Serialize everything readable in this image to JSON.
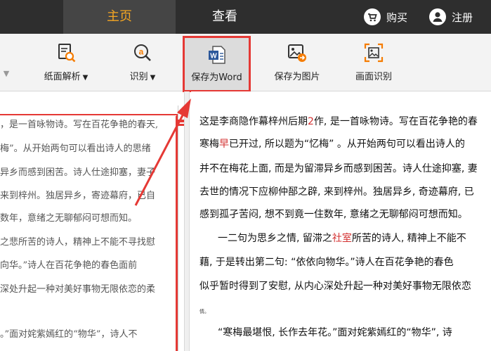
{
  "topbar": {
    "tabs": [
      {
        "label": "主页",
        "active": true
      },
      {
        "label": "查看",
        "active": false
      }
    ],
    "buy_label": "购买",
    "register_label": "注册"
  },
  "toolbar": {
    "analyze_label": "纸面解析",
    "recog_label": "识别",
    "save_word_label": "保存为Word",
    "save_image_label": "保存为图片",
    "screen_recog_label": "画面识别",
    "caret": "▼"
  },
  "left_text": [
    "，是一首咏物诗。写在百花争艳的春天,",
    "梅”。从开始两句可以看出诗人的思绪",
    "异乡而感到困苦。诗人仕途抑塞，妻子",
    "来到梓州。独居异乡，寄迹幕府，已自",
    "数年，意绪之无聊郁闷可想而知。",
    "之悲所苦的诗人，精神上不能不寻找慰",
    "向华。”诗人在百花争艳的春色面前",
    "深处升起一种对美好事物无限依恋的柔",
    "。”面对姹紫嫣红的“物华”，诗人不"
  ],
  "right_text": {
    "l1_a": "这是李商隐作幕梓州后期",
    "l1_r": "2",
    "l1_b": "作, 是一首咏物诗。写在百花争艳的春",
    "l2_a": "寒梅",
    "l2_r": "早",
    "l2_b": "已开过, 所以题为“忆梅”  。从开始两句可以看出诗人的",
    "l3": "并不在梅花上面, 而是为留滞异乡而感到困苦。诗人仕途抑塞, 妻",
    "l4": "去世的情况下应柳仲郚之辟, 来到梓州。独居异乡, 奇迹幕府, 已",
    "l5": "感到孤孑苦闷, 想不到竟一住数年, 意绪之无聊郁闷可想而知。",
    "l6_a": "一二句为思乡之情,  留滞之",
    "l6_r": "社室",
    "l6_b": "所苦的诗人,  精神上不能不",
    "l7": "藉, 于是转出第二句:   “依依向物华。”诗人在百花争艳的春色",
    "l8": "似乎暂时得到了安慰,  从内心深处升起一种对美好事物无限依恋",
    "l9": "情。",
    "l10": "“寒梅最堪恨, 长作去年花。”面对姹紫嫣红的“物华”, 诗"
  },
  "colors": {
    "accent": "#f5a623",
    "highlight": "#e53935",
    "topbar": "#2e2e2e"
  },
  "icons": [
    "cart-icon",
    "user-icon",
    "document-scan-icon",
    "search-a-icon",
    "word-doc-icon",
    "image-export-icon",
    "screen-capture-icon"
  ]
}
